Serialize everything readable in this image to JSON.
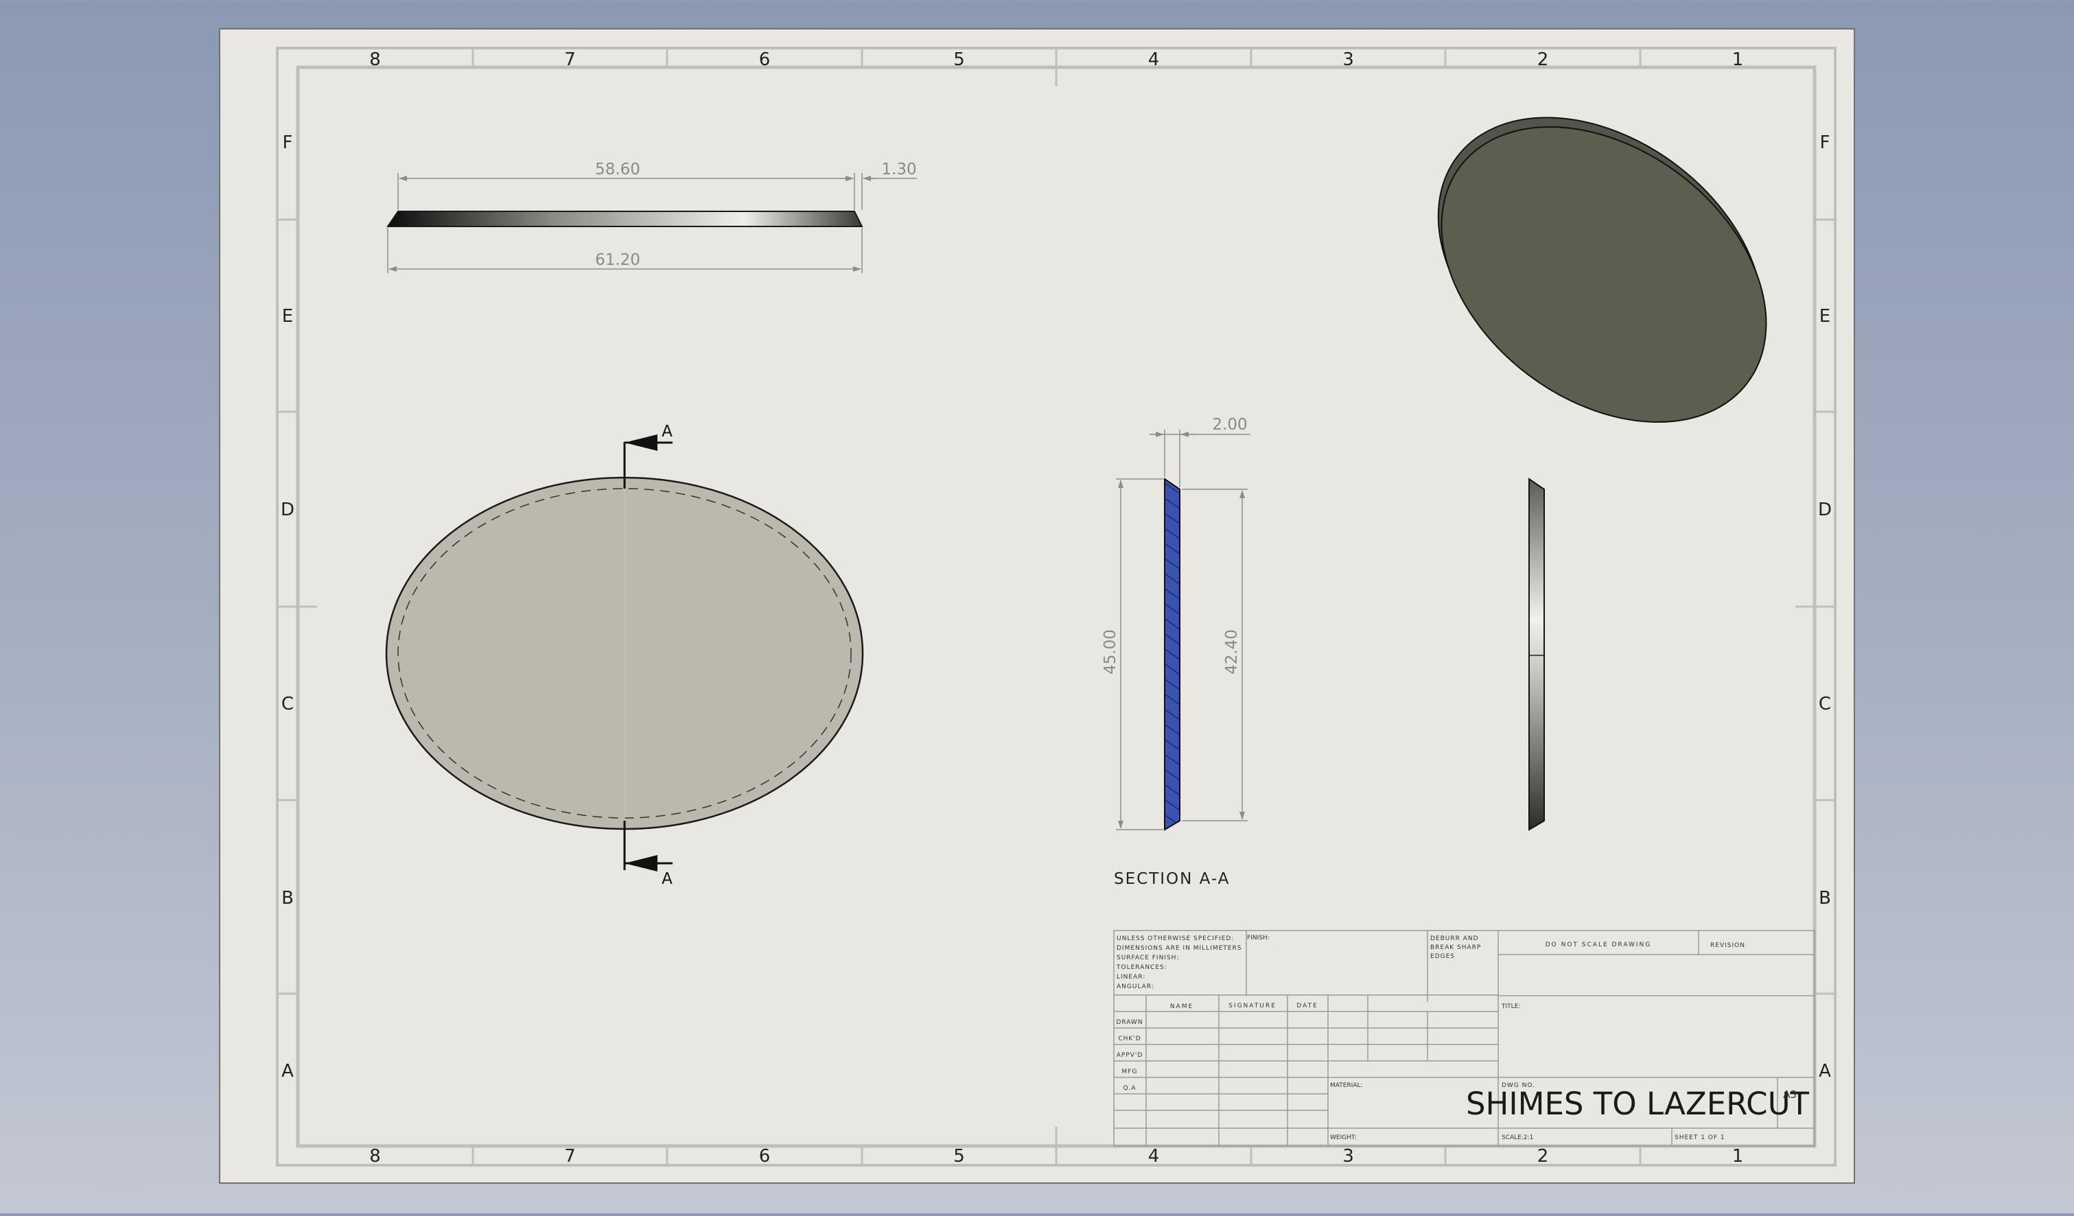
{
  "sheet": {
    "zones_columns": [
      "8",
      "7",
      "6",
      "5",
      "4",
      "3",
      "2",
      "1"
    ],
    "zones_rows": [
      "F",
      "E",
      "D",
      "C",
      "B",
      "A"
    ],
    "colors": {
      "paper": "#e8e7e1",
      "line": "#bcbcb7",
      "ink": "#222222",
      "dim": "#888888",
      "face_gray": "#bbb8ad",
      "iso_face": "#5d5d50",
      "section_fill": "#3a52b0"
    }
  },
  "front_view": {
    "dim_top": "58.60",
    "dim_thickness": "1.30",
    "dim_bottom": "61.20"
  },
  "top_view": {
    "section_letter_top": "A",
    "section_letter_bottom": "A"
  },
  "section_view": {
    "dim_thickness": "2.00",
    "dim_outer": "45.00",
    "dim_inner": "42.40",
    "label": "SECTION A-A"
  },
  "title_block": {
    "unless_lines": [
      "UNLESS OTHERWISE SPECIFIED:",
      "DIMENSIONS ARE IN MILLIMETERS",
      "SURFACE FINISH:",
      "TOLERANCES:",
      "   LINEAR:",
      "   ANGULAR:"
    ],
    "finish": "FINISH:",
    "deburr_lines": [
      "DEBURR AND",
      "BREAK SHARP",
      "EDGES"
    ],
    "do_not_scale": "DO NOT SCALE DRAWING",
    "revision": "REVISION",
    "col_name": "NAME",
    "col_signature": "SIGNATURE",
    "col_date": "DATE",
    "rows": [
      "DRAWN",
      "CHK'D",
      "APPV'D",
      "MFG",
      "Q.A"
    ],
    "title_label": "TITLE:",
    "material": "MATERIAL:",
    "dwg_no": "DWG NO.",
    "drawing_title": "SHIMES TO LAZERCUT",
    "size": "A3",
    "weight": "WEIGHT:",
    "scale": "SCALE:2:1",
    "sheet": "SHEET 1 OF 1"
  }
}
